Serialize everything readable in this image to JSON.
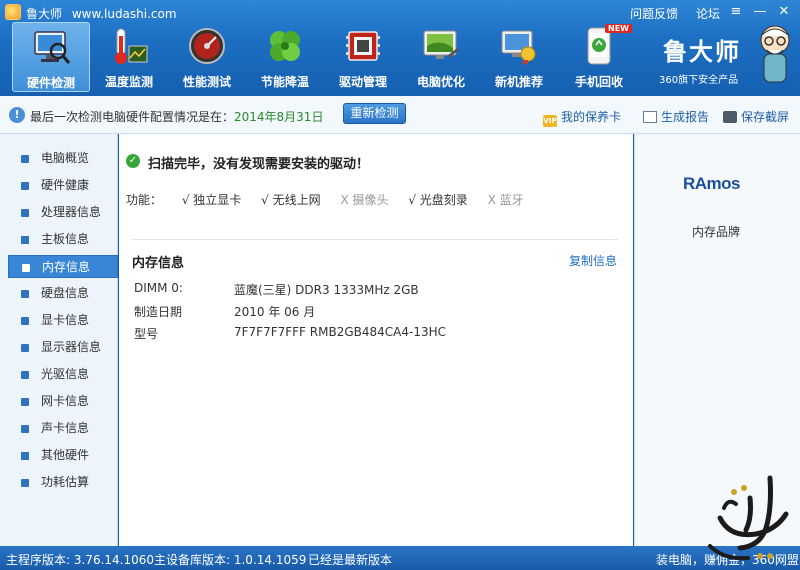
{
  "titlebar": {
    "app_name": "鲁大师",
    "url": "www.ludashi.com",
    "feedback": "问题反馈",
    "forum": "论坛",
    "menu_glyph": "≡",
    "minimize_glyph": "—",
    "close_glyph": "✕"
  },
  "toolbar": {
    "items": [
      {
        "label": "硬件检测",
        "icon": "hardware-check-icon"
      },
      {
        "label": "温度监测",
        "icon": "thermometer-icon"
      },
      {
        "label": "性能测试",
        "icon": "speedometer-icon"
      },
      {
        "label": "节能降温",
        "icon": "leaf-icon"
      },
      {
        "label": "驱动管理",
        "icon": "driver-chip-icon"
      },
      {
        "label": "电脑优化",
        "icon": "monitor-optimize-icon"
      },
      {
        "label": "新机推荐",
        "icon": "new-pc-icon"
      },
      {
        "label": "手机回收",
        "icon": "phone-recycle-icon"
      }
    ],
    "new_badge": "NEW"
  },
  "brand": {
    "name": "鲁大师",
    "sub": "360旗下安全产品"
  },
  "infobar": {
    "text": "最后一次检测电脑硬件配置情况是在：",
    "date": "2014年8月31日",
    "recheck": "重新检测",
    "warranty": "我的保养卡",
    "report": "生成报告",
    "screenshot": "保存截屏",
    "vip": "VIP"
  },
  "sidebar": {
    "items": [
      "电脑概览",
      "硬件健康",
      "处理器信息",
      "主板信息",
      "内存信息",
      "硬盘信息",
      "显卡信息",
      "显示器信息",
      "光驱信息",
      "网卡信息",
      "声卡信息",
      "其他硬件",
      "功耗估算"
    ],
    "active": "内存信息"
  },
  "main": {
    "scan_title": "扫描完毕，没有发现需要安装的驱动！",
    "func_label": "功能：",
    "features": [
      {
        "label": "√ 独立显卡",
        "on": true
      },
      {
        "label": "√ 无线上网",
        "on": true
      },
      {
        "label": "X 摄像头",
        "on": false
      },
      {
        "label": "√ 光盘刻录",
        "on": true
      },
      {
        "label": "X 蓝牙",
        "on": false
      }
    ],
    "section_title": "内存信息",
    "copy": "复制信息",
    "rows": [
      {
        "key": "DIMM 0:",
        "value": "蓝魔(三星) DDR3 1333MHz 2GB"
      },
      {
        "key": "制造日期",
        "value": "2010 年 06 月"
      },
      {
        "key": "型号",
        "value": "7F7F7F7FFF RMB2GB484CA4-13HC"
      }
    ]
  },
  "rpanel": {
    "logo": "RAmos",
    "brand_label": "内存品牌"
  },
  "status": {
    "main_version": "主程序版本: 3.76.14.1060",
    "db_version": "主设备库版本: 1.0.14.1059",
    "latest": "已经是最新版本",
    "right_link": "装电脑，赚佣金，360网盟"
  },
  "colors": {
    "header": "#1d6fc3",
    "accent": "#3a86d6",
    "ok_green": "#3aa63a",
    "date_green": "#2a8a2a",
    "link_blue": "#1f6fc4"
  }
}
